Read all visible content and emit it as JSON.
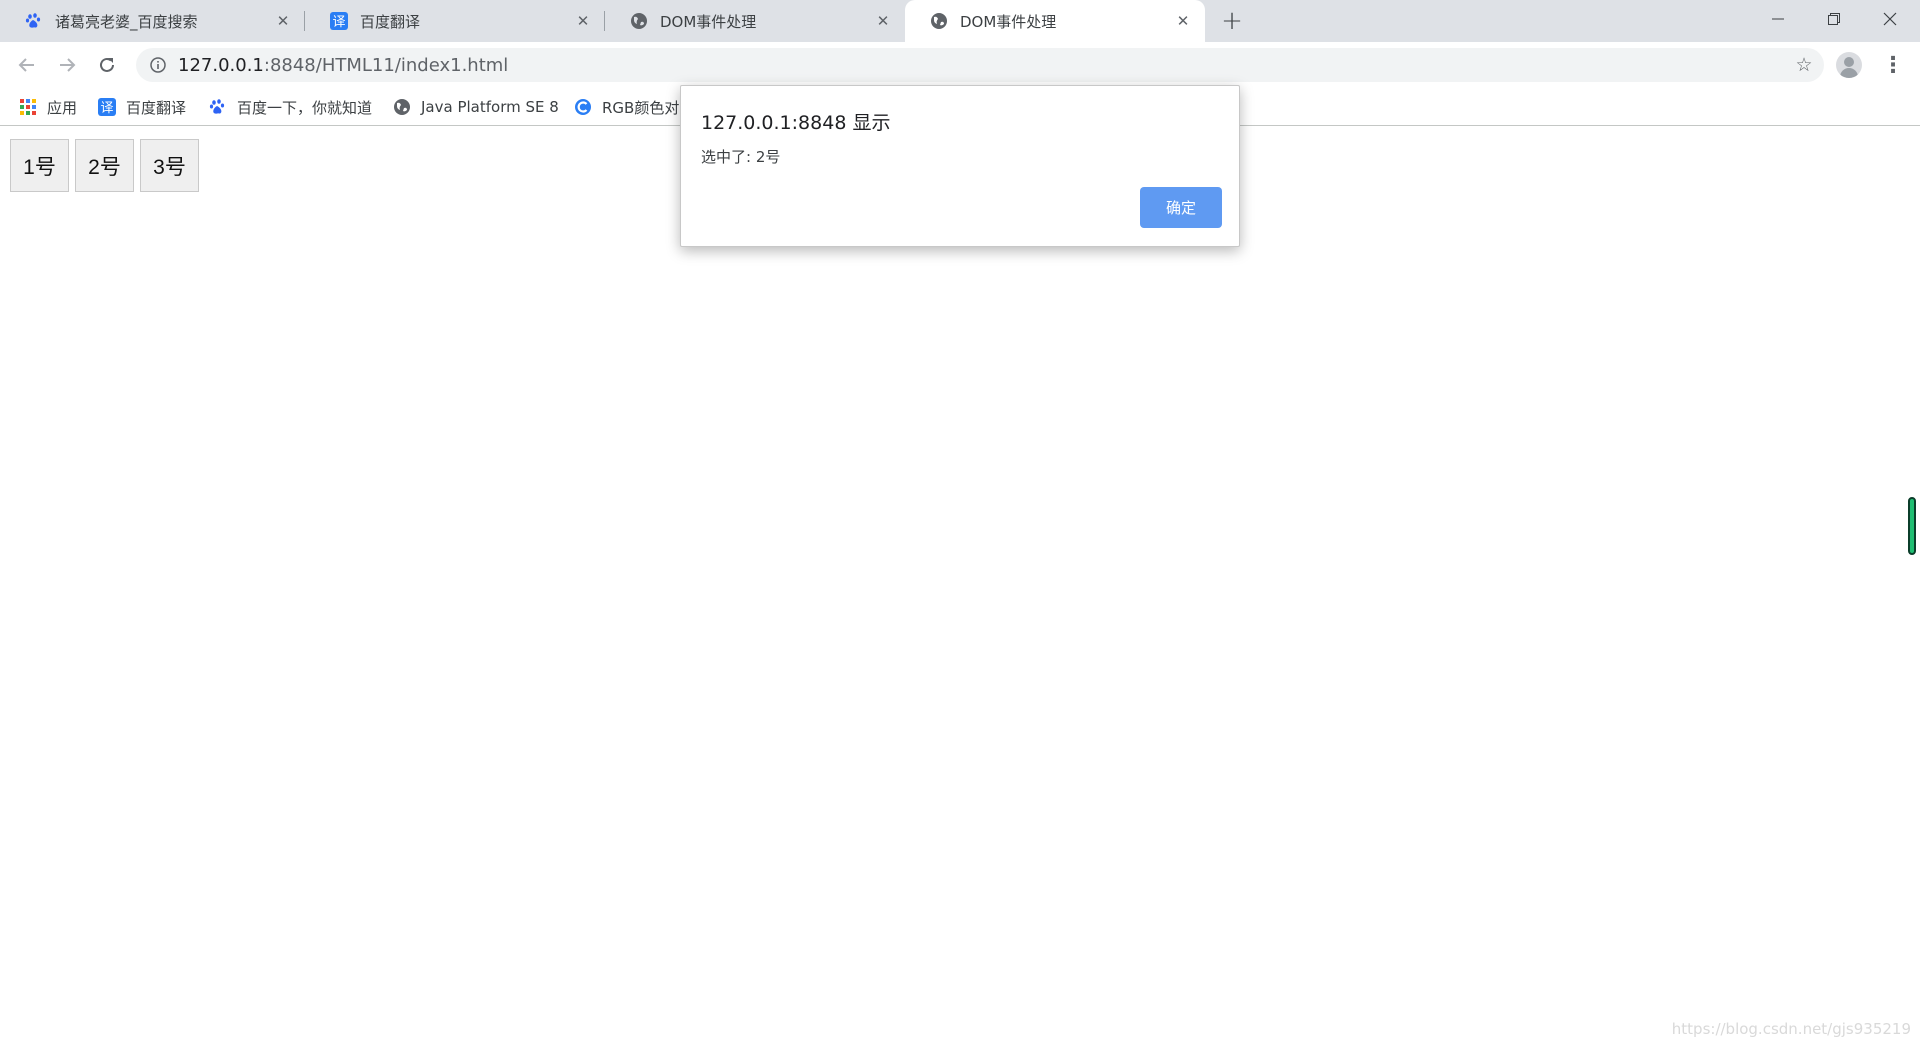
{
  "tabs": [
    {
      "title": "诸葛亮老婆_百度搜索",
      "icon": "baidu-paw-icon",
      "active": false
    },
    {
      "title": "百度翻译",
      "icon": "baidu-translate-icon",
      "active": false
    },
    {
      "title": "DOM事件处理",
      "icon": "globe-icon",
      "active": false
    },
    {
      "title": "DOM事件处理",
      "icon": "globe-icon",
      "active": true
    }
  ],
  "toolbar": {
    "url_host": "127.0.0.1",
    "url_path": ":8848/HTML11/index1.html"
  },
  "bookmarks": [
    {
      "label": "应用",
      "icon": "apps-grid-icon"
    },
    {
      "label": "百度翻译",
      "icon": "baidu-translate-icon"
    },
    {
      "label": "百度一下，你就知道",
      "icon": "baidu-paw-icon"
    },
    {
      "label": "Java Platform SE 8",
      "icon": "globe-icon"
    },
    {
      "label": "RGB颜色对",
      "icon": "rgb-site-icon"
    }
  ],
  "page": {
    "buttons": [
      "1号",
      "2号",
      "3号"
    ],
    "watermark": "https://blog.csdn.net/gjs935219"
  },
  "dialog": {
    "title": "127.0.0.1:8848 显示",
    "message": "选中了: 2号",
    "ok_label": "确定"
  },
  "colors": {
    "tabstrip_bg": "#dee1e6",
    "accent_blue": "#5f9af2",
    "baidu_blue": "#2e63f4",
    "translate_blue": "#2a7ef4"
  }
}
